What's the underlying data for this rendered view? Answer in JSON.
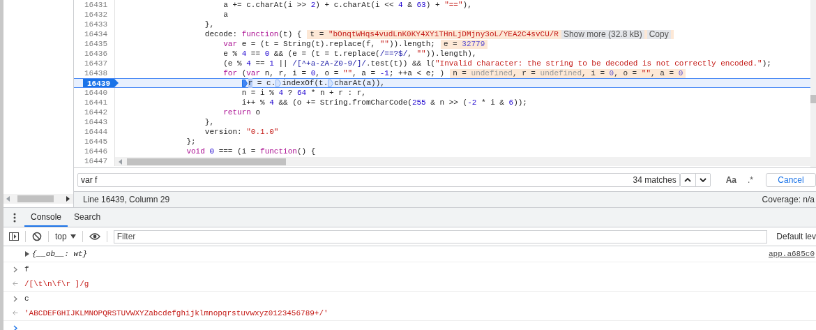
{
  "editor": {
    "lines": [
      {
        "number": "16431",
        "current": false,
        "tokens": [
          {
            "kind": "p",
            "text": "                      a += c.charAt(i >> "
          },
          {
            "kind": "num",
            "text": "2"
          },
          {
            "kind": "p",
            "text": ") + c.charAt(i << "
          },
          {
            "kind": "num",
            "text": "4"
          },
          {
            "kind": "p",
            "text": " & "
          },
          {
            "kind": "num",
            "text": "63"
          },
          {
            "kind": "p",
            "text": ") + "
          },
          {
            "kind": "str",
            "text": "\"==\""
          },
          {
            "kind": "p",
            "text": "),"
          }
        ]
      },
      {
        "number": "16432",
        "current": false,
        "tokens": [
          {
            "kind": "p",
            "text": "                      a"
          }
        ]
      },
      {
        "number": "16433",
        "current": false,
        "tokens": [
          {
            "kind": "p",
            "text": "                  },"
          }
        ]
      },
      {
        "number": "16434",
        "current": false,
        "tokens": [
          {
            "kind": "p",
            "text": "                  decode: "
          },
          {
            "kind": "kw",
            "text": "function"
          },
          {
            "kind": "p",
            "text": "(t) {"
          }
        ],
        "inline": [
          {
            "kind": "p",
            "text": "t = "
          },
          {
            "kind": "str",
            "text": "\"bOnqtWHqs4vudLnK0KY4XY1THnLjDMjny3oL/YEA2C4svCU/R"
          },
          {
            "kind": "btn",
            "text": "Show more (32.8 kB)"
          },
          {
            "kind": "btn",
            "text": "Copy"
          }
        ]
      },
      {
        "number": "16435",
        "current": false,
        "tokens": [
          {
            "kind": "kw",
            "text": "                      var"
          },
          {
            "kind": "p",
            "text": " e = (t = String(t).replace(f, "
          },
          {
            "kind": "str",
            "text": "\"\""
          },
          {
            "kind": "p",
            "text": ")).length;"
          }
        ],
        "inline": [
          {
            "kind": "p",
            "text": "e = "
          },
          {
            "kind": "num",
            "text": "32779"
          }
        ]
      },
      {
        "number": "16436",
        "current": false,
        "tokens": [
          {
            "kind": "p",
            "text": "                      e % "
          },
          {
            "kind": "num",
            "text": "4"
          },
          {
            "kind": "p",
            "text": " == "
          },
          {
            "kind": "num",
            "text": "0"
          },
          {
            "kind": "p",
            "text": " && (e = (t = t.replace("
          },
          {
            "kind": "re",
            "text": "/==?$/"
          },
          {
            "kind": "p",
            "text": ", "
          },
          {
            "kind": "str",
            "text": "\"\""
          },
          {
            "kind": "p",
            "text": ")).length),"
          }
        ]
      },
      {
        "number": "16437",
        "current": false,
        "tokens": [
          {
            "kind": "p",
            "text": "                      (e % "
          },
          {
            "kind": "num",
            "text": "4"
          },
          {
            "kind": "p",
            "text": " == "
          },
          {
            "kind": "num",
            "text": "1"
          },
          {
            "kind": "p",
            "text": " || "
          },
          {
            "kind": "re",
            "text": "/[^+a-zA-Z0-9/]/"
          },
          {
            "kind": "p",
            "text": ".test(t)) && l("
          },
          {
            "kind": "str",
            "text": "\"Invalid character: the string to be decoded is not correctly encoded.\""
          },
          {
            "kind": "p",
            "text": ");"
          }
        ]
      },
      {
        "number": "16438",
        "current": false,
        "tokens": [
          {
            "kind": "kw",
            "text": "                      for"
          },
          {
            "kind": "p",
            "text": " ("
          },
          {
            "kind": "kw",
            "text": "var"
          },
          {
            "kind": "p",
            "text": " n, r, i = "
          },
          {
            "kind": "num",
            "text": "0"
          },
          {
            "kind": "p",
            "text": ", o = "
          },
          {
            "kind": "str",
            "text": "\"\""
          },
          {
            "kind": "p",
            "text": ", a = "
          },
          {
            "kind": "num",
            "text": "-1"
          },
          {
            "kind": "p",
            "text": "; ++a < e; )"
          }
        ],
        "inline": [
          {
            "kind": "p",
            "text": "n = "
          },
          {
            "kind": "undef",
            "text": "undefined"
          },
          {
            "kind": "p",
            "text": ", r = "
          },
          {
            "kind": "undef",
            "text": "undefined"
          },
          {
            "kind": "p",
            "text": ", i = "
          },
          {
            "kind": "num",
            "text": "0"
          },
          {
            "kind": "p",
            "text": ", o = "
          },
          {
            "kind": "str",
            "text": "\"\""
          },
          {
            "kind": "p",
            "text": ", a = "
          },
          {
            "kind": "num",
            "text": "0"
          }
        ]
      },
      {
        "number": "16439",
        "current": true,
        "tokens": [
          {
            "kind": "bp",
            "active": true
          },
          {
            "kind": "sel",
            "text": "                          r"
          },
          {
            "kind": "p",
            "text": " = c."
          },
          {
            "kind": "bp",
            "active": false
          },
          {
            "kind": "p",
            "text": "indexOf(t."
          },
          {
            "kind": "bp",
            "active": false
          },
          {
            "kind": "p",
            "text": "charAt(a)),"
          }
        ]
      },
      {
        "number": "16440",
        "current": false,
        "tokens": [
          {
            "kind": "p",
            "text": "                          n = i % "
          },
          {
            "kind": "num",
            "text": "4"
          },
          {
            "kind": "p",
            "text": " ? "
          },
          {
            "kind": "num",
            "text": "64"
          },
          {
            "kind": "p",
            "text": " * n + r : r,"
          }
        ]
      },
      {
        "number": "16441",
        "current": false,
        "tokens": [
          {
            "kind": "p",
            "text": "                          i++ % "
          },
          {
            "kind": "num",
            "text": "4"
          },
          {
            "kind": "p",
            "text": " && (o += String.fromCharCode("
          },
          {
            "kind": "num",
            "text": "255"
          },
          {
            "kind": "p",
            "text": " & n >> ("
          },
          {
            "kind": "num",
            "text": "-2"
          },
          {
            "kind": "p",
            "text": " * i & "
          },
          {
            "kind": "num",
            "text": "6"
          },
          {
            "kind": "p",
            "text": "));"
          }
        ]
      },
      {
        "number": "16442",
        "current": false,
        "tokens": [
          {
            "kind": "kw",
            "text": "                      return"
          },
          {
            "kind": "p",
            "text": " o"
          }
        ]
      },
      {
        "number": "16443",
        "current": false,
        "tokens": [
          {
            "kind": "p",
            "text": "                  },"
          }
        ]
      },
      {
        "number": "16444",
        "current": false,
        "tokens": [
          {
            "kind": "p",
            "text": "                  version: "
          },
          {
            "kind": "str",
            "text": "\"0.1.0\""
          }
        ]
      },
      {
        "number": "16445",
        "current": false,
        "tokens": [
          {
            "kind": "p",
            "text": "              };"
          }
        ]
      },
      {
        "number": "16446",
        "current": false,
        "tokens": [
          {
            "kind": "kw",
            "text": "              void "
          },
          {
            "kind": "num",
            "text": "0"
          },
          {
            "kind": "p",
            "text": " === (i = "
          },
          {
            "kind": "kw",
            "text": "function"
          },
          {
            "kind": "p",
            "text": "() {"
          }
        ]
      },
      {
        "number": "16447",
        "current": false
      }
    ]
  },
  "search_bar": {
    "value": "var f",
    "match_count": "34 matches",
    "case_button": "Aa",
    "regex_button": ".*",
    "cancel_button": "Cancel"
  },
  "status_bar": {
    "position": "Line 16439, Column 29",
    "coverage": "Coverage: n/a"
  },
  "drawer_tabs": [
    {
      "label": "Console",
      "selected": true
    },
    {
      "label": "Search",
      "selected": false
    }
  ],
  "console_toolbar": {
    "context": "top",
    "filter_placeholder": "Filter",
    "levels": "Default lev"
  },
  "console_messages": [
    {
      "kind": "object",
      "text": "{__ob__: wt}",
      "source": "app.a685c0"
    },
    {
      "kind": "input",
      "text": "f"
    },
    {
      "kind": "result",
      "text": "/[\\t\\n\\f\\r ]/g"
    },
    {
      "kind": "input",
      "text": "c"
    },
    {
      "kind": "result",
      "text": "'ABCDEFGHIJKLMNOPQRSTUVWXYZabcdefghijklmnopqrstuvwxyz0123456789+/'"
    },
    {
      "kind": "prompt"
    }
  ]
}
